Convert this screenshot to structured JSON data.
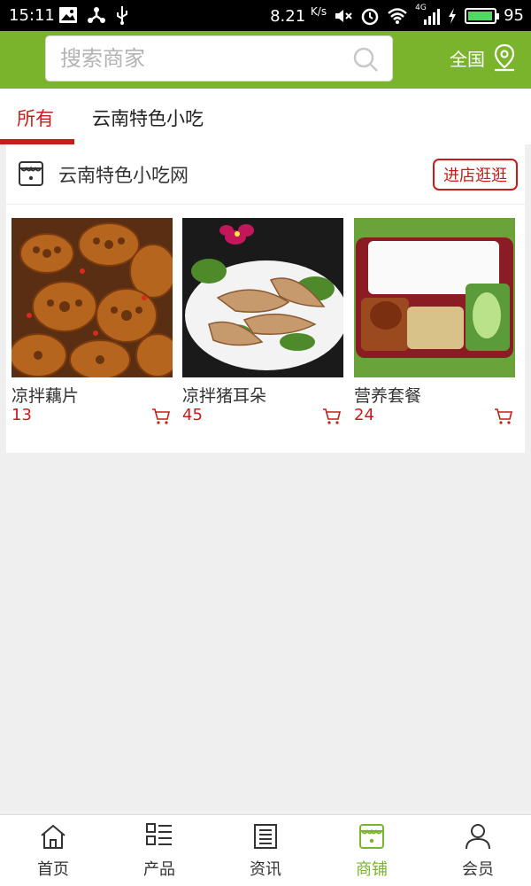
{
  "status_bar": {
    "time": "15:11",
    "net_speed": "8.21",
    "net_unit": "K/s",
    "signal": "4G",
    "battery_percent": "95",
    "battery_level": 0.95,
    "battery_color": "#4cd964"
  },
  "header": {
    "accent_color": "#7ab42c",
    "search_placeholder": "搜索商家",
    "region_label": "全国"
  },
  "tabs": [
    {
      "label": "所有",
      "active": true
    },
    {
      "label": "云南特色小吃",
      "active": false
    }
  ],
  "store": {
    "name": "云南特色小吃网",
    "visit_label": "进店逛逛",
    "products": [
      {
        "name": "凉拌藕片",
        "price": "13",
        "image": "food-photo-lotus-root"
      },
      {
        "name": "凉拌猪耳朵",
        "price": "45",
        "image": "food-photo-pig-ear"
      },
      {
        "name": "营养套餐",
        "price": "24",
        "image": "food-photo-bento"
      }
    ]
  },
  "bottom_nav": [
    {
      "label": "首页",
      "icon": "home-icon",
      "active": false
    },
    {
      "label": "产品",
      "icon": "list-icon",
      "active": false
    },
    {
      "label": "资讯",
      "icon": "news-icon",
      "active": false
    },
    {
      "label": "商铺",
      "icon": "shop-icon",
      "active": true
    },
    {
      "label": "会员",
      "icon": "user-icon",
      "active": false
    }
  ],
  "colors": {
    "accent": "#7ab42c",
    "price_red": "#c81b1b",
    "background": "#efefef"
  }
}
